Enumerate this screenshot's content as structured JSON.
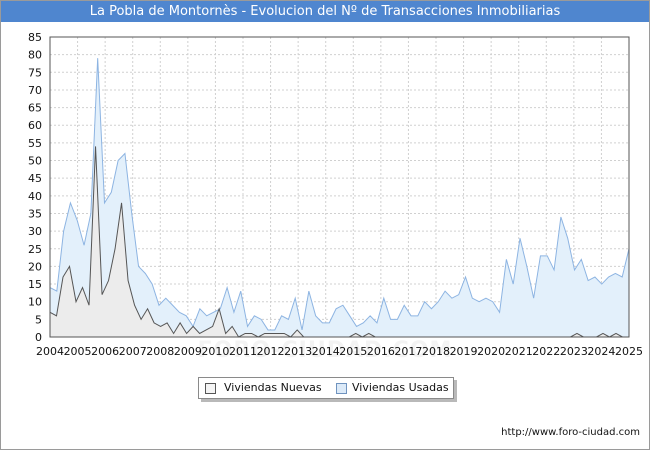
{
  "chart_data": {
    "type": "area",
    "title": "La Pobla de Montornès - Evolucion del Nº de Transacciones Inmobiliarias",
    "xlabel": "",
    "ylabel": "",
    "ylim": [
      0,
      85
    ],
    "y_ticks": [
      0,
      5,
      10,
      15,
      20,
      25,
      30,
      35,
      40,
      45,
      50,
      55,
      60,
      65,
      70,
      75,
      80,
      85
    ],
    "x_tick_labels": [
      "2004",
      "2005",
      "2006",
      "2007",
      "2008",
      "2009",
      "2010",
      "2011",
      "2012",
      "2013",
      "2014",
      "2015",
      "2016",
      "2017",
      "2018",
      "2019",
      "2020",
      "2021",
      "2022",
      "2023",
      "2024",
      "2025"
    ],
    "xlim": [
      2004,
      2025
    ],
    "grid": true,
    "legend_position": "bottom-center",
    "series": [
      {
        "name": "Viviendas Nuevas",
        "color": "#555555",
        "fill": "#ececec",
        "values": [
          7,
          6,
          17,
          20,
          10,
          14,
          9,
          54,
          12,
          16,
          25,
          38,
          16,
          9,
          5,
          8,
          4,
          3,
          4,
          1,
          4,
          1,
          3,
          1,
          2,
          3,
          8,
          1,
          3,
          0,
          1,
          1,
          0,
          1,
          1,
          1,
          1,
          0,
          2,
          0,
          0,
          0,
          0,
          0,
          0,
          0,
          0,
          1,
          0,
          1,
          0,
          0,
          0,
          0,
          0,
          0,
          0,
          0,
          0,
          0,
          0,
          0,
          0,
          0,
          0,
          0,
          0,
          0,
          0,
          0,
          0,
          0,
          0,
          0,
          0,
          0,
          0,
          0,
          0,
          0,
          0,
          1,
          0,
          0,
          0,
          1,
          0,
          1,
          0,
          0
        ]
      },
      {
        "name": "Viviendas Usadas",
        "color": "#8db4e2",
        "fill": "#e3f0fb",
        "values": [
          14,
          13,
          30,
          38,
          33,
          26,
          35,
          79,
          38,
          41,
          50,
          52,
          35,
          20,
          18,
          15,
          9,
          11,
          9,
          7,
          6,
          3,
          8,
          6,
          7,
          8,
          14,
          7,
          13,
          3,
          6,
          5,
          2,
          2,
          6,
          5,
          11,
          2,
          13,
          6,
          4,
          4,
          8,
          9,
          6,
          3,
          4,
          6,
          4,
          11,
          5,
          5,
          9,
          6,
          6,
          10,
          8,
          10,
          13,
          11,
          12,
          17,
          11,
          10,
          11,
          10,
          7,
          22,
          15,
          28,
          20,
          11,
          23,
          23,
          19,
          34,
          28,
          19,
          22,
          16,
          17,
          15,
          17,
          18,
          17,
          25
        ]
      }
    ]
  },
  "source": "http://www.foro-ciudad.com",
  "watermark": "FORO-CIUDAD.COM"
}
